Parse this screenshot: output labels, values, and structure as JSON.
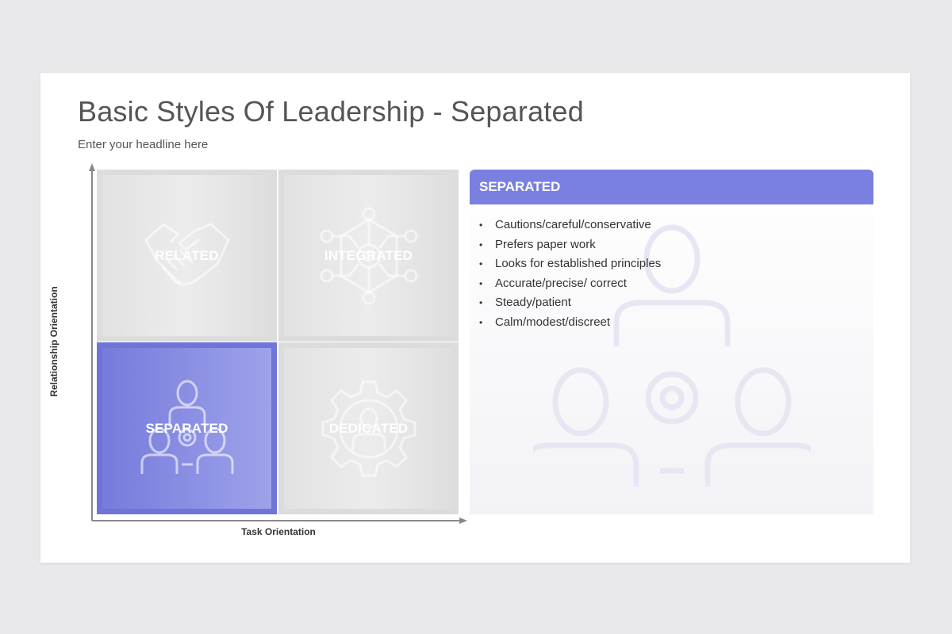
{
  "slide": {
    "title": "Basic Styles Of Leadership - Separated",
    "subtitle": "Enter your headline here"
  },
  "axes": {
    "y_label": "Relationship Orientation",
    "x_label": "Task Orientation"
  },
  "quadrants": [
    {
      "label": "RELATED",
      "icon": "handshake-icon",
      "active": false
    },
    {
      "label": "INTEGRATED",
      "icon": "network-gear-icon",
      "active": false
    },
    {
      "label": "SEPARATED",
      "icon": "people-gear-icon",
      "active": true
    },
    {
      "label": "DEDICATED",
      "icon": "person-in-gear-icon",
      "active": false
    }
  ],
  "panel": {
    "title": "SEPARATED",
    "background_icon": "people-gear-icon",
    "bullets": [
      "Cautions/careful/conservative",
      "Prefers paper work",
      "Looks for established principles",
      "Accurate/precise/ correct",
      "Steady/patient",
      "Calm/modest/discreet"
    ]
  },
  "colors": {
    "accent": "#7a80e0",
    "quadrant_inactive": "#dcdcdc",
    "background": "#e9e8ea"
  }
}
